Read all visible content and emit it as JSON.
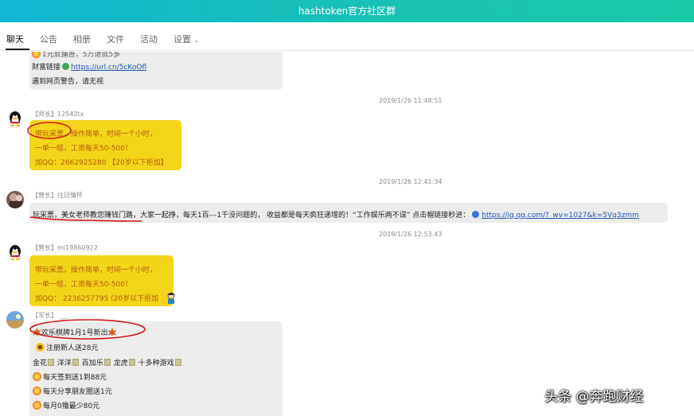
{
  "window": {
    "title": "hashtoken官方社区群"
  },
  "tabs": [
    {
      "label": "聊天",
      "active": true
    },
    {
      "label": "公告"
    },
    {
      "label": "相册"
    },
    {
      "label": "文件"
    },
    {
      "label": "活动"
    },
    {
      "label": "设置"
    }
  ],
  "messages": {
    "m0": {
      "line0": "1元就捕吾，5万退就5多",
      "line1_prefix": "财富链接",
      "line1_link": "https://url.cn/5cKoOfl",
      "line2": "遇到网页警告，请无视"
    },
    "m1": {
      "time": "2019/1/26 11:48:51",
      "sender": "【师长】12542tx",
      "line1a": "带玩采票",
      "line1b": "，操作简单，时间一个小时，",
      "line2": "一单一结，工资每天50-500！",
      "line3": "加QQ：2662925280 【20岁以下拒加】"
    },
    "m2": {
      "time": "2019/1/26 12:41:34",
      "sender": "【营长】往日情怀",
      "text": "玩采票，美女老师教您赚钱门路，大家一起挣，每天1百---1千没问题的， 收益都是每天疯狂递增的！“工作娱乐两不误” 点击帽链接秒进：",
      "link": "https://jq.qq.com/?_wv=1027&k=5Vq3zmm"
    },
    "m3": {
      "time": "2019/1/26 12:53:43",
      "sender": "【营长】mi19860922",
      "line1": "带玩采票，操作简单，时间一个小时，",
      "line2": "一单一结，工资每天50-500！",
      "line3": "加QQ：  2236257795 (20岁以下拒加"
    },
    "m4": {
      "sender": "【军长】",
      "line1": "欢乐棋牌1月1号新出",
      "line2": "注册新人送28元",
      "games": [
        "金花",
        "洋洋",
        "百加乐",
        "龙虎",
        "十多种游戏"
      ],
      "line4": "每天签到送1到88元",
      "line5": "每天分享朋友圈送1元",
      "line6": "每月0撸最少80元"
    }
  },
  "watermark": {
    "text": "头条 @奔跑财经"
  },
  "colors": {
    "titlebar": "#14bdc0",
    "yellow_bubble": "#f4d51a",
    "gray_bubble": "#ececec",
    "link": "#1f56b8",
    "annotation": "#d0161c"
  }
}
